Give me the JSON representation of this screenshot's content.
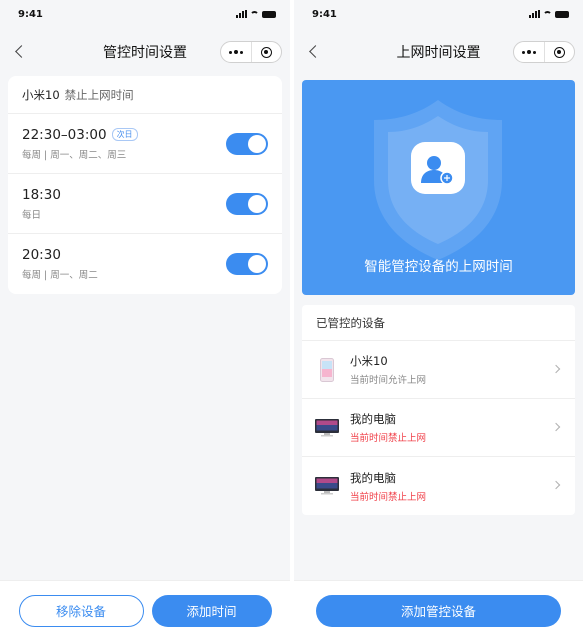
{
  "left": {
    "status_time": "9:41",
    "nav_title": "管控时间设置",
    "card": {
      "device": "小米10",
      "label": "禁止上网时间",
      "schedules": [
        {
          "time": "22:30–03:00",
          "badge": "次日",
          "repeat": "每周 | 周一、周二、周三",
          "enabled": true
        },
        {
          "time": "18:30",
          "badge": "",
          "repeat": "每日",
          "enabled": true
        },
        {
          "time": "20:30",
          "badge": "",
          "repeat": "每周 | 周一、周二",
          "enabled": true
        }
      ]
    },
    "buttons": {
      "remove": "移除设备",
      "add_time": "添加时间"
    }
  },
  "right": {
    "status_time": "9:41",
    "nav_title": "上网时间设置",
    "hero_text": "智能管控设备的上网时间",
    "devices_header": "已管控的设备",
    "devices": [
      {
        "name": "小米10",
        "status": "当前时间允许上网",
        "icon": "phone-icon",
        "denied": false
      },
      {
        "name": "我的电脑",
        "status": "当前时间禁止上网",
        "icon": "monitor-icon",
        "denied": true
      },
      {
        "name": "我的电脑",
        "status": "当前时间禁止上网",
        "icon": "monitor-icon",
        "denied": true
      }
    ],
    "buttons": {
      "add_device": "添加管控设备"
    }
  },
  "colors": {
    "accent": "#3b8cf0",
    "hero": "#4a98f2",
    "deny": "#f0414a"
  }
}
